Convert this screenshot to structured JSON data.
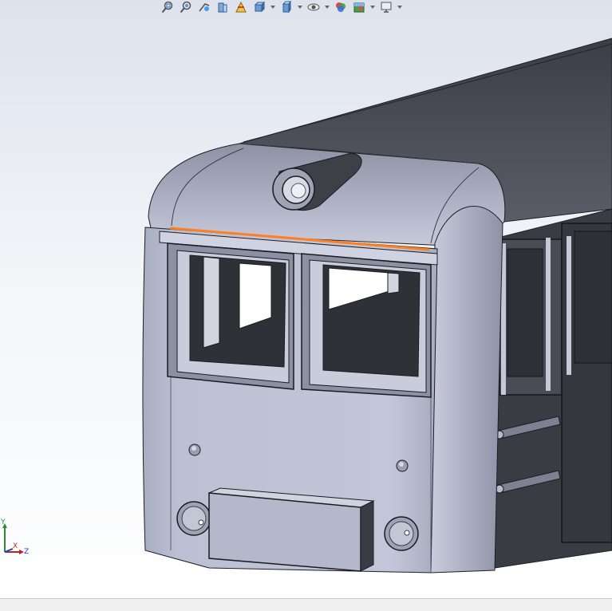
{
  "toolbar": {
    "items": [
      {
        "icon": "zoom-to-fit-icon",
        "has_dropdown": false
      },
      {
        "icon": "zoom-to-area-icon",
        "has_dropdown": false
      },
      {
        "icon": "previous-view-icon",
        "has_dropdown": false
      },
      {
        "icon": "section-view-icon",
        "has_dropdown": false
      },
      {
        "icon": "dynamic-annotation-icon",
        "has_dropdown": false
      },
      {
        "icon": "view-orientation-icon",
        "has_dropdown": true
      },
      {
        "icon": "display-style-icon",
        "has_dropdown": true
      },
      {
        "icon": "hide-show-items-icon",
        "has_dropdown": true
      },
      {
        "icon": "edit-appearance-icon",
        "has_dropdown": false
      },
      {
        "icon": "apply-scene-icon",
        "has_dropdown": true
      },
      {
        "icon": "view-settings-icon",
        "has_dropdown": true
      }
    ]
  },
  "triad": {
    "y_label": "Y",
    "x_label": "X",
    "z_label": "Z"
  },
  "colors": {
    "selected_edge": "#ff7f1e",
    "body_face": "#b8bccf",
    "roof_dark": "#4b4e58",
    "side_dark": "#34363d",
    "background_top": "#dde2ec",
    "background_bottom": "#ffffff"
  }
}
